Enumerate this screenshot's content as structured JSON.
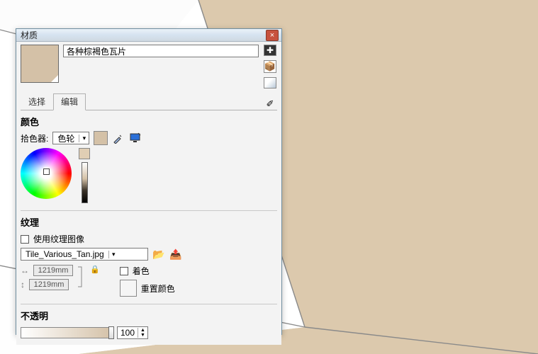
{
  "window": {
    "title": "材质",
    "close": "×"
  },
  "material_name": "各种棕褐色瓦片",
  "tabs": {
    "select": "选择",
    "edit": "编辑",
    "active": "edit"
  },
  "sections": {
    "color": "颜色",
    "texture": "纹理",
    "opacity": "不透明"
  },
  "picker": {
    "label": "拾色器:",
    "mode": "色轮",
    "swatch_color": "#d4c1a7"
  },
  "texture": {
    "use_label": "使用纹理图像",
    "use_checked": false,
    "file": "Tile_Various_Tan.jpg",
    "width": "1219mm",
    "height": "1219mm",
    "tint_label": "着色",
    "tint_checked": false,
    "reset_label": "重置颜色"
  },
  "opacity": {
    "value": "100"
  },
  "icons": {
    "create": "✚",
    "library": "📦",
    "gradient": "◩",
    "eyedrop": "✐",
    "wand": "wand",
    "monitor": "monitor",
    "folder": "📂",
    "export": "📤",
    "lr": "↔",
    "ud": "↕",
    "lock": "🔒",
    "dd": "▾",
    "up": "▲",
    "dn": "▼"
  }
}
